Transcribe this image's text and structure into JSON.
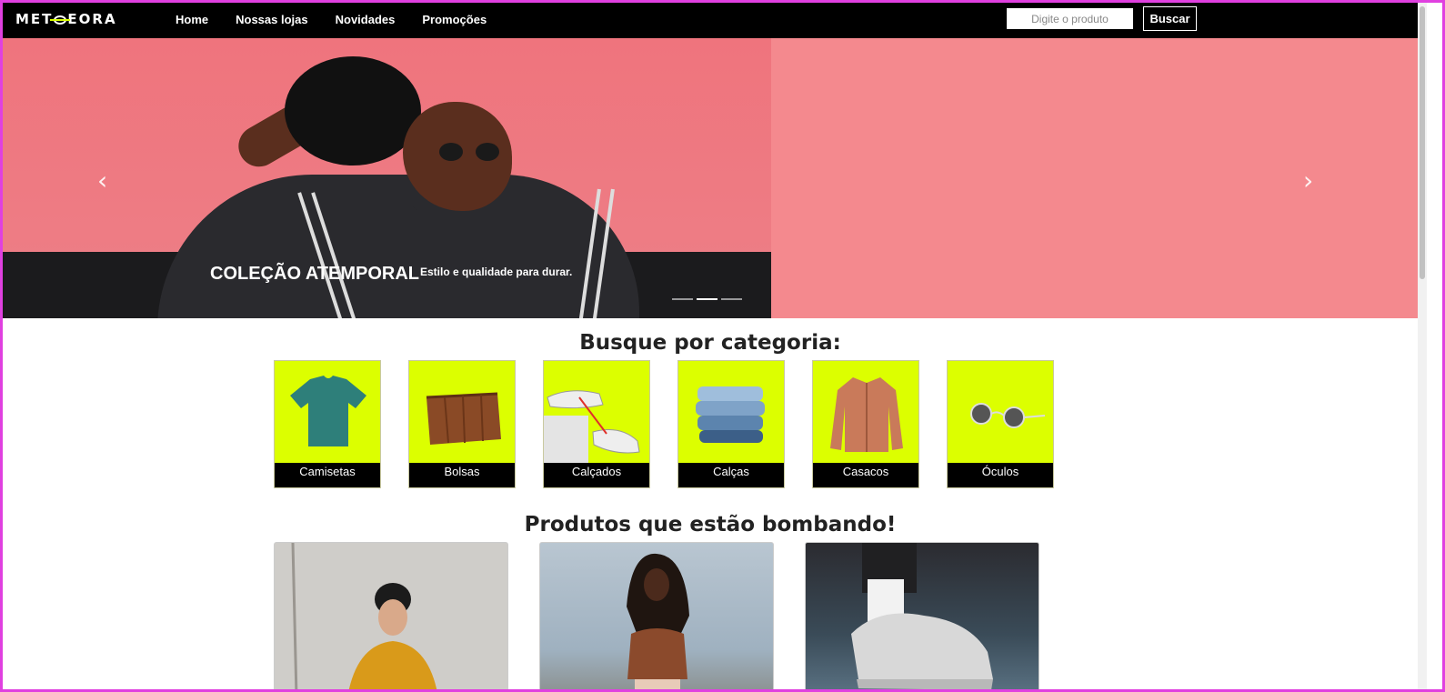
{
  "nav": {
    "logo": "METEORA",
    "links": [
      "Home",
      "Nossas lojas",
      "Novidades",
      "Promoções"
    ],
    "search_placeholder": "Digite o produto",
    "search_button": "Buscar"
  },
  "hero": {
    "title": "COLEÇÃO ATEMPORAL",
    "subtitle": "Estilo e qualidade para durar.",
    "prev_icon": "chevron-left-icon",
    "next_icon": "chevron-right-icon",
    "slide_count": 3,
    "active_slide": 2
  },
  "categories": {
    "title": "Busque por categoria:",
    "items": [
      "Camisetas",
      "Bolsas",
      "Calçados",
      "Calças",
      "Casacos",
      "Óculos"
    ]
  },
  "trending": {
    "title": "Produtos que estão bombando!"
  },
  "colors": {
    "accent": "#dcff00",
    "nav_bg": "#000000",
    "hero_bg": "#f4898e"
  }
}
